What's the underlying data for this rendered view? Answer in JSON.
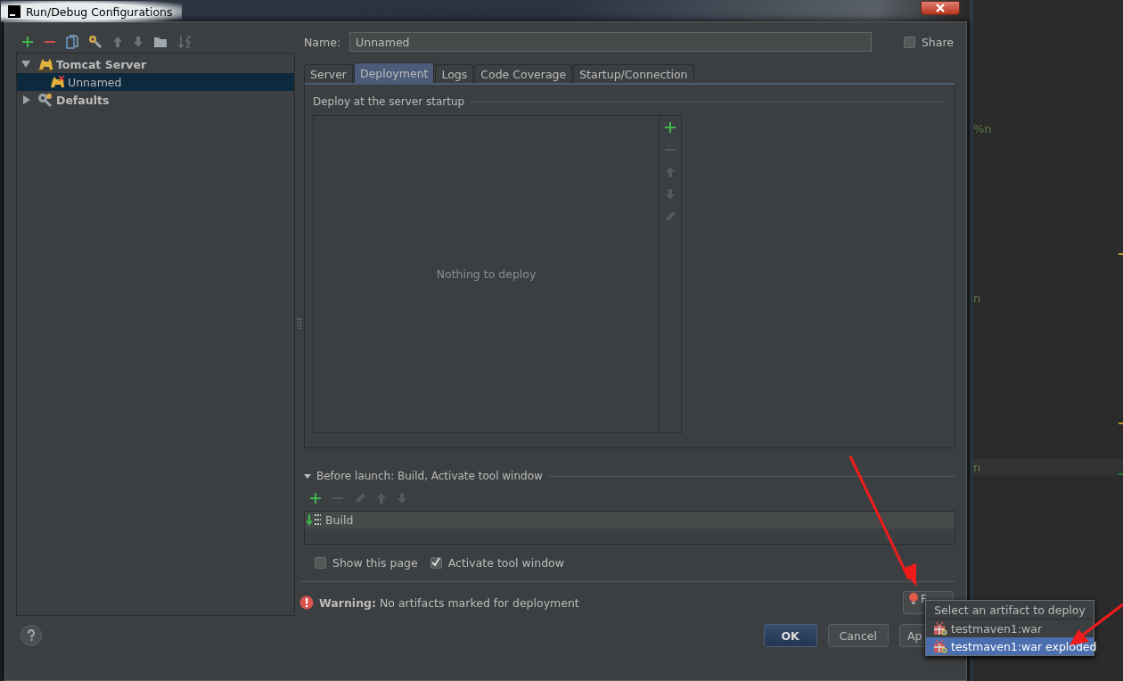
{
  "window": {
    "title": "Run/Debug Configurations"
  },
  "tree": [
    {
      "label": "Tomcat Server",
      "expanded": true,
      "selected": false,
      "children": [
        {
          "label": "Unnamed",
          "selected": true
        }
      ]
    },
    {
      "label": "Defaults",
      "expanded": false,
      "selected": false
    }
  ],
  "name_field": {
    "label": "Name:",
    "value": "Unnamed"
  },
  "share": {
    "label": "Share",
    "checked": false
  },
  "tabs": [
    {
      "label": "Server",
      "selected": false
    },
    {
      "label": "Deployment",
      "selected": true
    },
    {
      "label": "Logs",
      "selected": false
    },
    {
      "label": "Code Coverage",
      "selected": false
    },
    {
      "label": "Startup/Connection",
      "selected": false
    }
  ],
  "deployment": {
    "section_title": "Deploy at the server startup",
    "empty_text": "Nothing to deploy"
  },
  "before_launch": {
    "title": "Before launch: Build, Activate tool window",
    "expanded": true,
    "tasks": [
      {
        "label": "Build",
        "selected": true
      }
    ]
  },
  "options": [
    {
      "label": "Show this page",
      "checked": false
    },
    {
      "label": "Activate tool window",
      "checked": true
    }
  ],
  "warning": {
    "text": "**Warning:** No artifacts marked for deployment"
  },
  "fix_button": {
    "label": "F"
  },
  "buttons": [
    {
      "label": "OK",
      "kind": "default"
    },
    {
      "label": "Cancel",
      "kind": "normal"
    },
    {
      "label": "Ap",
      "kind": "normal"
    }
  ],
  "popup": {
    "title": "Select an artifact to deploy",
    "items": [
      {
        "label": "testmaven1:war",
        "selected": false
      },
      {
        "label": "testmaven1:war exploded",
        "selected": true
      }
    ]
  },
  "editor": {
    "lines": [
      "%n",
      "n",
      "n"
    ]
  }
}
